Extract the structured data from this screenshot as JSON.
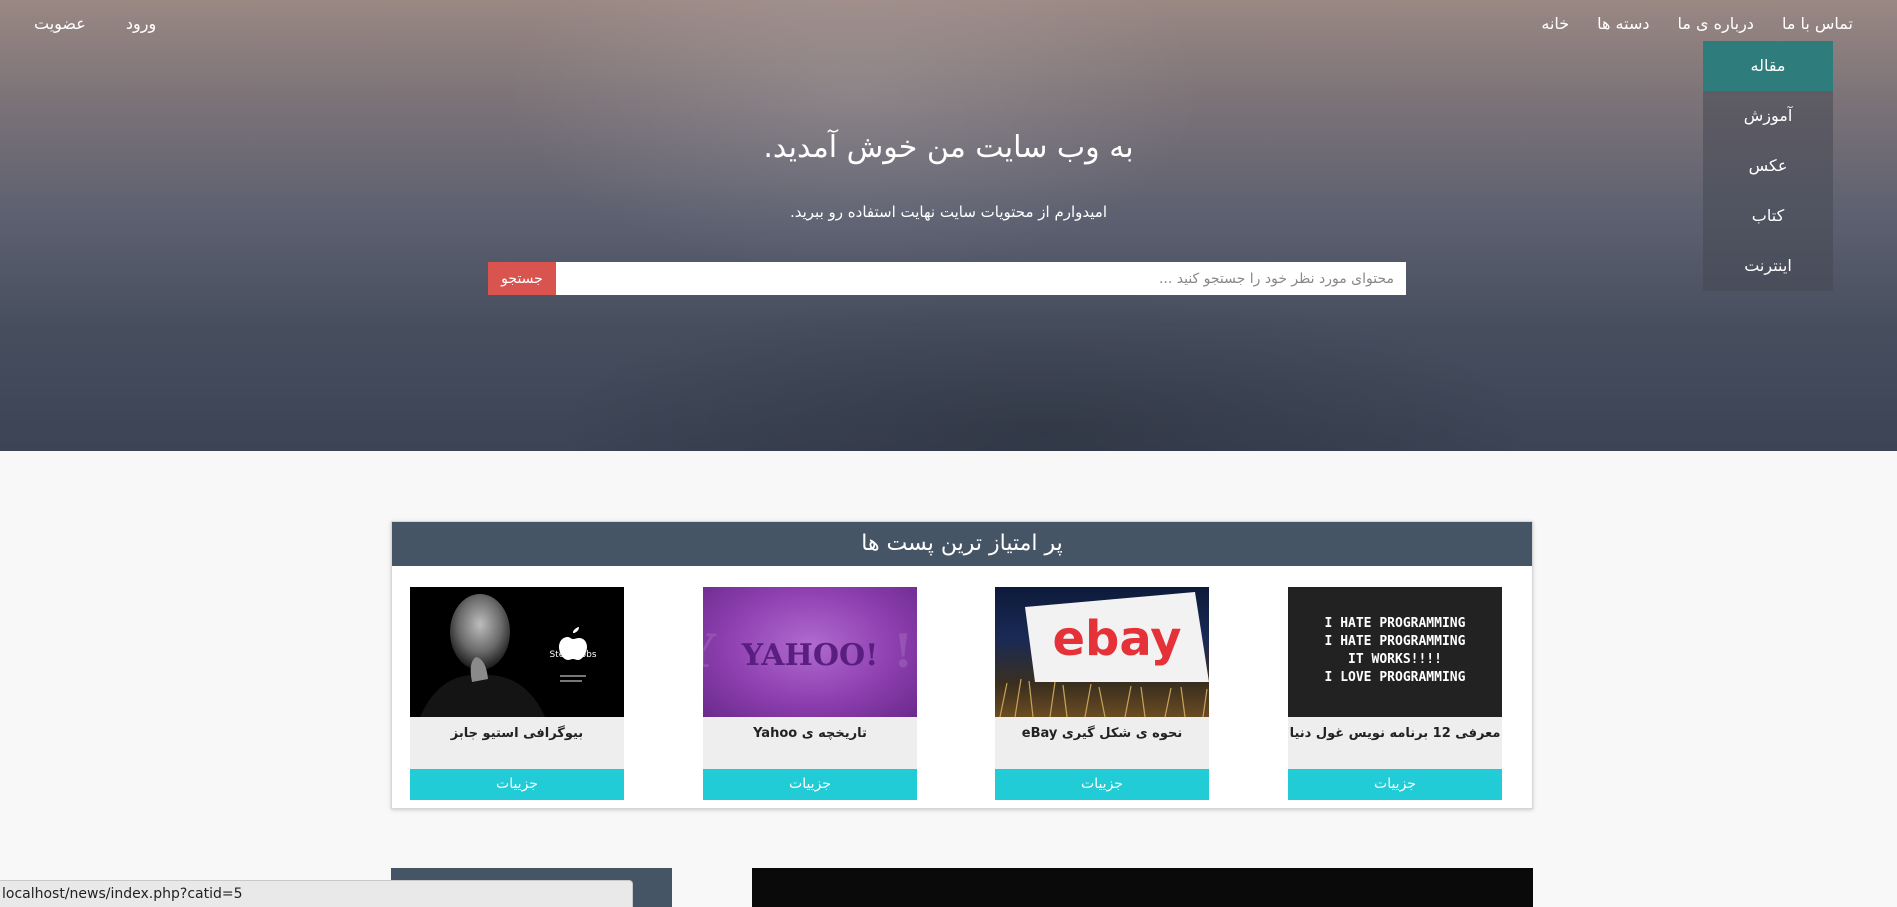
{
  "nav": {
    "items": [
      {
        "label": "خانه"
      },
      {
        "label": "دسته ها"
      },
      {
        "label": "درباره ی ما"
      },
      {
        "label": "تماس با ما"
      }
    ],
    "dropdown": [
      {
        "label": "مقاله",
        "active": true
      },
      {
        "label": "آموزش"
      },
      {
        "label": "عکس"
      },
      {
        "label": "کتاب"
      },
      {
        "label": "اینترنت"
      }
    ]
  },
  "auth": {
    "login_label": "ورود",
    "register_label": "عضویت"
  },
  "hero": {
    "title": "به وب سایت من خوش آمدید.",
    "subtitle": "امیدوارم از محتویات سایت نهایت استفاده رو ببرید."
  },
  "search": {
    "placeholder": "محتوای مورد نظر خود را جستجو کنید ...",
    "value": "",
    "button_label": "جستجو"
  },
  "top_posts": {
    "title": "پر امتیاز ترین پست ها",
    "cards": [
      {
        "title": "معرفی 12 برنامه نویس غول دنیا",
        "button": "جزییات",
        "image": "programming-meme-image",
        "image_text": [
          "I HATE PROGRAMMING",
          "I HATE PROGRAMMING",
          "IT WORKS!!!!",
          "I LOVE PROGRAMMING"
        ]
      },
      {
        "title": "نحوه ی شکل گیری eBay",
        "button": "جزییات",
        "image": "ebay-sign-image",
        "image_text": [
          "ebay"
        ]
      },
      {
        "title": "تاریخچه ی Yahoo",
        "button": "جزییات",
        "image": "yahoo-logo-image",
        "image_text": [
          "YAHOO!"
        ]
      },
      {
        "title": "بیوگرافی استیو جابز",
        "button": "جزییات",
        "image": "steve-jobs-portrait-image",
        "image_text": [
          "Steve Jobs"
        ]
      }
    ]
  },
  "status_bar": {
    "url": "localhost/news/index.php?catid=5"
  },
  "colors": {
    "panel_header": "#465566",
    "details_button": "#22ccd6",
    "search_button": "#d9534f",
    "dropdown_active": "#2e7d7c"
  }
}
